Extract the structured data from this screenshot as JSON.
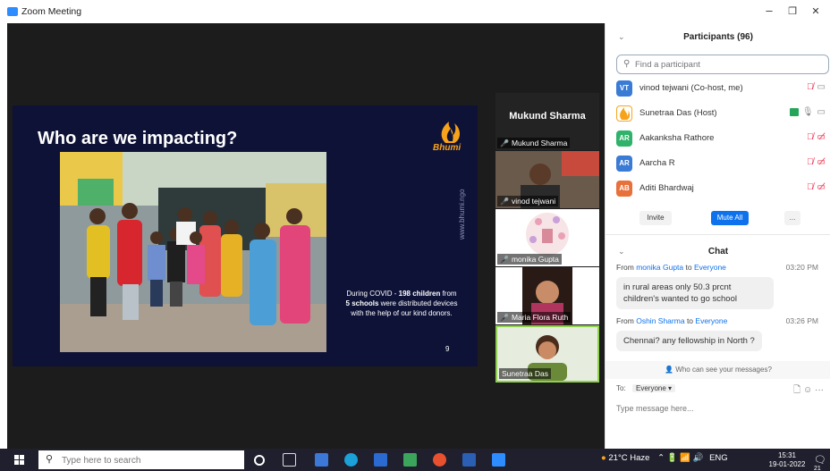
{
  "window": {
    "title": "Zoom Meeting",
    "minimize": "–",
    "maximize": "❐",
    "close": "✕"
  },
  "slide": {
    "title": "Who are we impacting?",
    "brand": "Bhumi",
    "url": "www.bhumi.ngo",
    "caption_pre": "During COVID - ",
    "caption_num1": "198",
    "caption_mid1": " children",
    "caption_mid2": " from ",
    "caption_num2": "5 schools",
    "caption_post": " were distributed devices with the help of our kind donors.",
    "page": "9"
  },
  "gallery": [
    {
      "name": "Mukund Sharma",
      "big_label": "Mukund Sharma",
      "muted": true
    },
    {
      "name": "vinod tejwani",
      "muted": true
    },
    {
      "name": "monika Gupta",
      "muted": true
    },
    {
      "name": "Maria Flora Ruth",
      "muted": true
    },
    {
      "name": "Sunetraa Das",
      "muted": false
    }
  ],
  "participants": {
    "header": "Participants (96)",
    "search_placeholder": "Find a participant",
    "list": [
      {
        "initials": "VT",
        "name": "vinod tejwani (Co-host, me)",
        "color": "#3a7bd5"
      },
      {
        "initials": "",
        "name": "Sunetraa Das (Host)",
        "color": "#f5a623"
      },
      {
        "initials": "AR",
        "name": "Aakanksha Rathore",
        "color": "#2fb36b"
      },
      {
        "initials": "AR",
        "name": "Aarcha R",
        "color": "#3a7bd5"
      },
      {
        "initials": "AB",
        "name": "Aditi Bhardwaj",
        "color": "#e8703a"
      }
    ],
    "invite_label": "Invite",
    "mute_all_label": "Mute All",
    "more_label": "..."
  },
  "chat": {
    "header": "Chat",
    "messages": [
      {
        "from": "monika Gupta",
        "to": "Everyone",
        "time": "03:20 PM",
        "text": "in rural areas only 50.3 prcnt children's wanted to go school"
      },
      {
        "from": "Oshin Sharma",
        "to": "Everyone",
        "time": "03:26 PM",
        "text": "Chennai? any fellowship in North ?"
      }
    ],
    "from_word": "From",
    "to_word": "to",
    "who_can_see": "Who can see your messages?",
    "to_label": "To:",
    "to_value": "Everyone",
    "input_placeholder": "Type message here..."
  },
  "taskbar": {
    "search_placeholder": "Type here to search",
    "weather": "21°C Haze",
    "language": "ENG",
    "time": "15:31",
    "date": "19-01-2022",
    "notif_count": "21"
  }
}
